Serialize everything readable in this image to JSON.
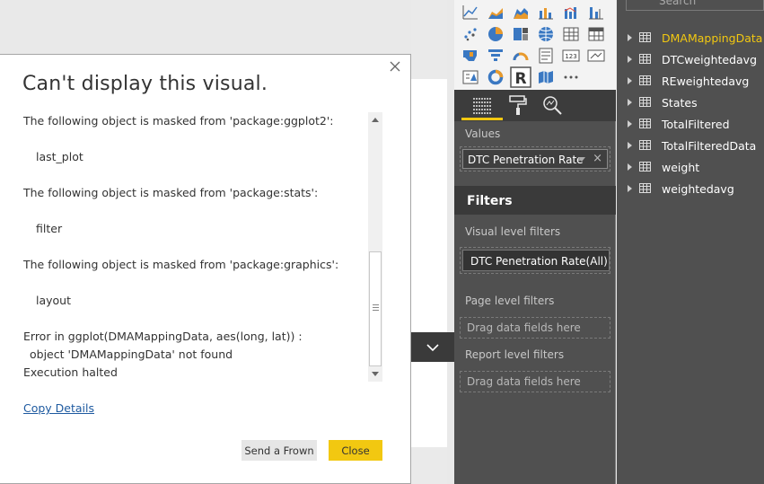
{
  "dialog": {
    "title": "Can't display this visual.",
    "message_lines": [
      "The following object is masked from 'package:ggplot2':",
      "last_plot",
      "The following object is masked from 'package:stats':",
      "filter",
      "The following object is masked from 'package:graphics':",
      "layout",
      "Error in ggplot(DMAMappingData, aes(long, lat)) :",
      "object 'DMAMappingData' not found",
      "Execution halted"
    ],
    "copy_details": "Copy Details",
    "send_frown": "Send a Frown",
    "close": "Close"
  },
  "visualizations": {
    "icons": [
      "line-chart-icon",
      "area-chart-icon",
      "stacked-area-icon",
      "line-clustered-column-icon",
      "line-stacked-column-icon",
      "ribbon-chart-icon",
      "scatter-chart-icon",
      "pie-chart-icon",
      "treemap-icon",
      "map-icon",
      "table-icon",
      "matrix-icon",
      "filled-map-icon",
      "funnel-icon",
      "gauge-icon",
      "multi-row-card-icon",
      "card-icon",
      "kpi-icon",
      "slicer-icon",
      "donut-chart-icon",
      "r-script-visual-icon",
      "shape-map-icon",
      "more-visuals-icon"
    ],
    "values_label": "Values",
    "values_field": "DTC Penetration Rate",
    "filters_heading": "Filters",
    "visual_level_label": "Visual level filters",
    "visual_level_filter": "DTC Penetration Rate(All)",
    "page_level_label": "Page level filters",
    "page_drop": "Drag data fields here",
    "report_level_label": "Report level filters",
    "report_drop": "Drag data fields here"
  },
  "fields": {
    "search_placeholder": "Search",
    "tables": [
      {
        "name": "DMAMappingData",
        "active": true
      },
      {
        "name": "DTCweightedavg",
        "active": false
      },
      {
        "name": "REweightedavg",
        "active": false
      },
      {
        "name": "States",
        "active": false
      },
      {
        "name": "TotalFiltered",
        "active": false
      },
      {
        "name": "TotalFilteredData",
        "active": false
      },
      {
        "name": "weight",
        "active": false
      },
      {
        "name": "weightedavg",
        "active": false
      }
    ]
  },
  "colors": {
    "accent": "#f2c811",
    "link": "#1e5aa0",
    "pane_bg": "#505050"
  }
}
